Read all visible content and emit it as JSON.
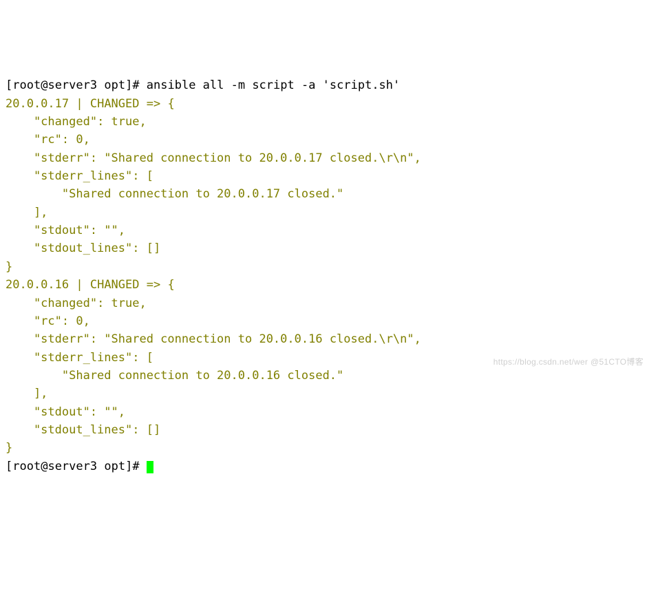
{
  "prompt1": {
    "open": "[",
    "user": "root",
    "at": "@",
    "host": "server3",
    "cwd": " opt",
    "close": "]",
    "hash": "# ",
    "command": "ansible all -m script -a 'script.sh'"
  },
  "hosts": [
    {
      "header_ip": "20.0.0.17",
      "header_sep": " | ",
      "header_status": "CHANGED",
      "header_arrow": " => {",
      "changed_key": "    \"changed\"",
      "changed_val": ": true,",
      "rc_key": "    \"rc\"",
      "rc_val": ": 0,",
      "stderr_key": "    \"stderr\"",
      "stderr_val": ": \"Shared connection to 20.0.0.17 closed.\\r\\n\",",
      "stderr_lines_key": "    \"stderr_lines\"",
      "stderr_lines_open": ": [",
      "stderr_line0": "        \"Shared connection to 20.0.0.17 closed.\"",
      "stderr_lines_close": "    ],",
      "stdout_key": "    \"stdout\"",
      "stdout_val": ": \"\",",
      "stdout_lines_key": "    \"stdout_lines\"",
      "stdout_lines_val": ": []",
      "close": "}"
    },
    {
      "header_ip": "20.0.0.16",
      "header_sep": " | ",
      "header_status": "CHANGED",
      "header_arrow": " => {",
      "changed_key": "    \"changed\"",
      "changed_val": ": true,",
      "rc_key": "    \"rc\"",
      "rc_val": ": 0,",
      "stderr_key": "    \"stderr\"",
      "stderr_val": ": \"Shared connection to 20.0.0.16 closed.\\r\\n\",",
      "stderr_lines_key": "    \"stderr_lines\"",
      "stderr_lines_open": ": [",
      "stderr_line0": "        \"Shared connection to 20.0.0.16 closed.\"",
      "stderr_lines_close": "    ],",
      "stdout_key": "    \"stdout\"",
      "stdout_val": ": \"\",",
      "stdout_lines_key": "    \"stdout_lines\"",
      "stdout_lines_val": ": []",
      "close": "}"
    }
  ],
  "prompt2": {
    "open": "[",
    "user": "root",
    "at": "@",
    "host": "server3",
    "cwd": " opt",
    "close": "]",
    "hash": "# "
  },
  "watermark": "https://blog.csdn.net/wer @51CTO博客"
}
